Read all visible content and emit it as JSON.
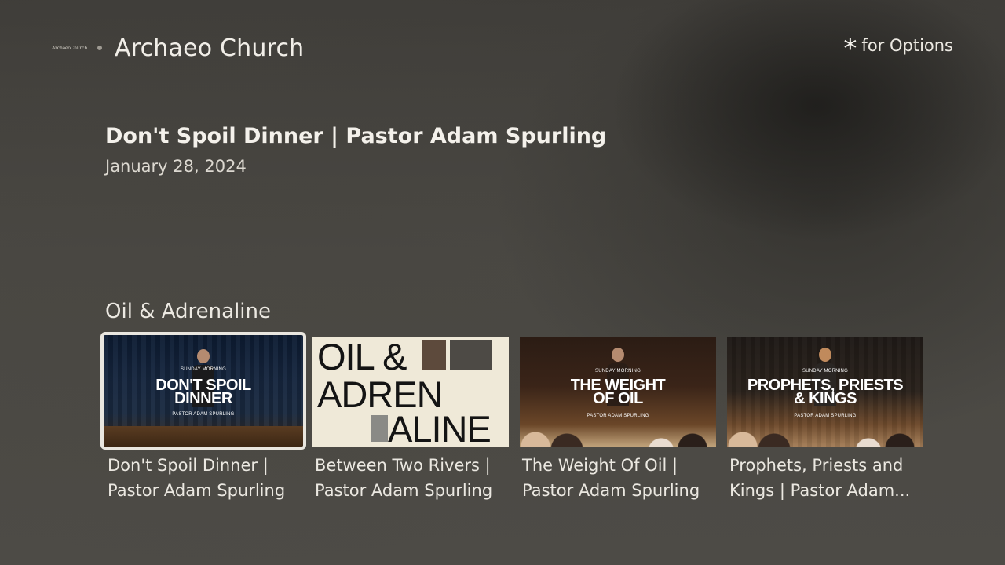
{
  "header": {
    "logo_text": "ArchaeoChurch",
    "channel_title": "Archaeo Church",
    "options_icon": "asterisk-icon",
    "options_text": "for Options"
  },
  "episode": {
    "title": "Don't Spoil Dinner | Pastor Adam Spurling",
    "date": "January 28, 2024"
  },
  "row": {
    "title": "Oil & Adrenaline",
    "cards": [
      {
        "label": "Don't Spoil Dinner |\nPastor Adam Spurling",
        "thumb_kicker": "SUNDAY MORNING",
        "thumb_title": "DON'T SPOIL DINNER",
        "thumb_speaker": "PASTOR ADAM SPURLING",
        "focused": true
      },
      {
        "label": "Between Two Rivers |\nPastor Adam Spurling",
        "thumb_line1": "OIL &",
        "thumb_line2": "ADREN",
        "thumb_line3": "ALINE"
      },
      {
        "label": "The Weight Of Oil |\nPastor Adam Spurling",
        "thumb_kicker": "SUNDAY MORNING",
        "thumb_title": "THE WEIGHT OF OIL",
        "thumb_speaker": "PASTOR ADAM SPURLING"
      },
      {
        "label": "Prophets, Priests and\nKings | Pastor Adam...",
        "thumb_kicker": "SUNDAY MORNING",
        "thumb_title": "PROPHETS, PRIESTS & KINGS",
        "thumb_speaker": "PASTOR ADAM SPURLING"
      }
    ]
  },
  "colors": {
    "background": "#4c4a45",
    "text": "#ece9e2",
    "focus_outline": "#e9e6df"
  }
}
